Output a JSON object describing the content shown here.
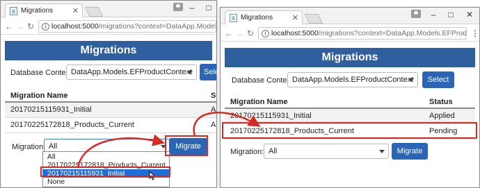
{
  "colors": {
    "header_blue": "#2f5f9e",
    "button_blue": "#2c65b6",
    "highlight_red": "#d62a23",
    "selected_option": "#1e6fd9"
  },
  "left_window": {
    "tab_title": "Migrations",
    "url_host": "localhost:5000",
    "url_rest": "/migrations?context=DataApp.Models.EFProductCont",
    "page_title": "Migrations",
    "context_label": "Database Context:",
    "context_value": "DataApp.Models.EFProductContext",
    "select_button": "Selec",
    "col_name": "Migration Name",
    "col_status": "Statu",
    "rows": [
      {
        "name": "20170215115931_Initial",
        "status": "Appl"
      },
      {
        "name": "20170225172818_Products_Current",
        "status": "App"
      }
    ],
    "migration_label": "Migration:",
    "migration_value": "All",
    "migrate_button": "Migrate",
    "options": [
      "All",
      "20170225172818_Products_Current",
      "20170215115931_Initial",
      "None"
    ]
  },
  "right_window": {
    "tab_title": "Migrations",
    "url_host": "localhost:5000",
    "url_rest": "/migrations?context=DataApp.Models.EFProductContext",
    "page_title": "Migrations",
    "context_label": "Database Context:",
    "context_value": "DataApp.Models.EFProductContext",
    "select_button": "Select",
    "col_name": "Migration Name",
    "col_status": "Status",
    "rows": [
      {
        "name": "20170215115931_Initial",
        "status": "Applied"
      },
      {
        "name": "20170225172818_Products_Current",
        "status": "Pending"
      }
    ],
    "migration_label": "Migration:",
    "migration_value": "All",
    "migrate_button": "Migrate"
  },
  "icons": [
    "page-favicon-icon",
    "tab-close-icon",
    "user-icon",
    "minimize-icon",
    "maximize-icon",
    "close-icon",
    "back-icon",
    "forward-icon",
    "reload-icon",
    "info-icon",
    "menu-dots-icon",
    "chevron-down-icon",
    "mouse-cursor-icon"
  ]
}
